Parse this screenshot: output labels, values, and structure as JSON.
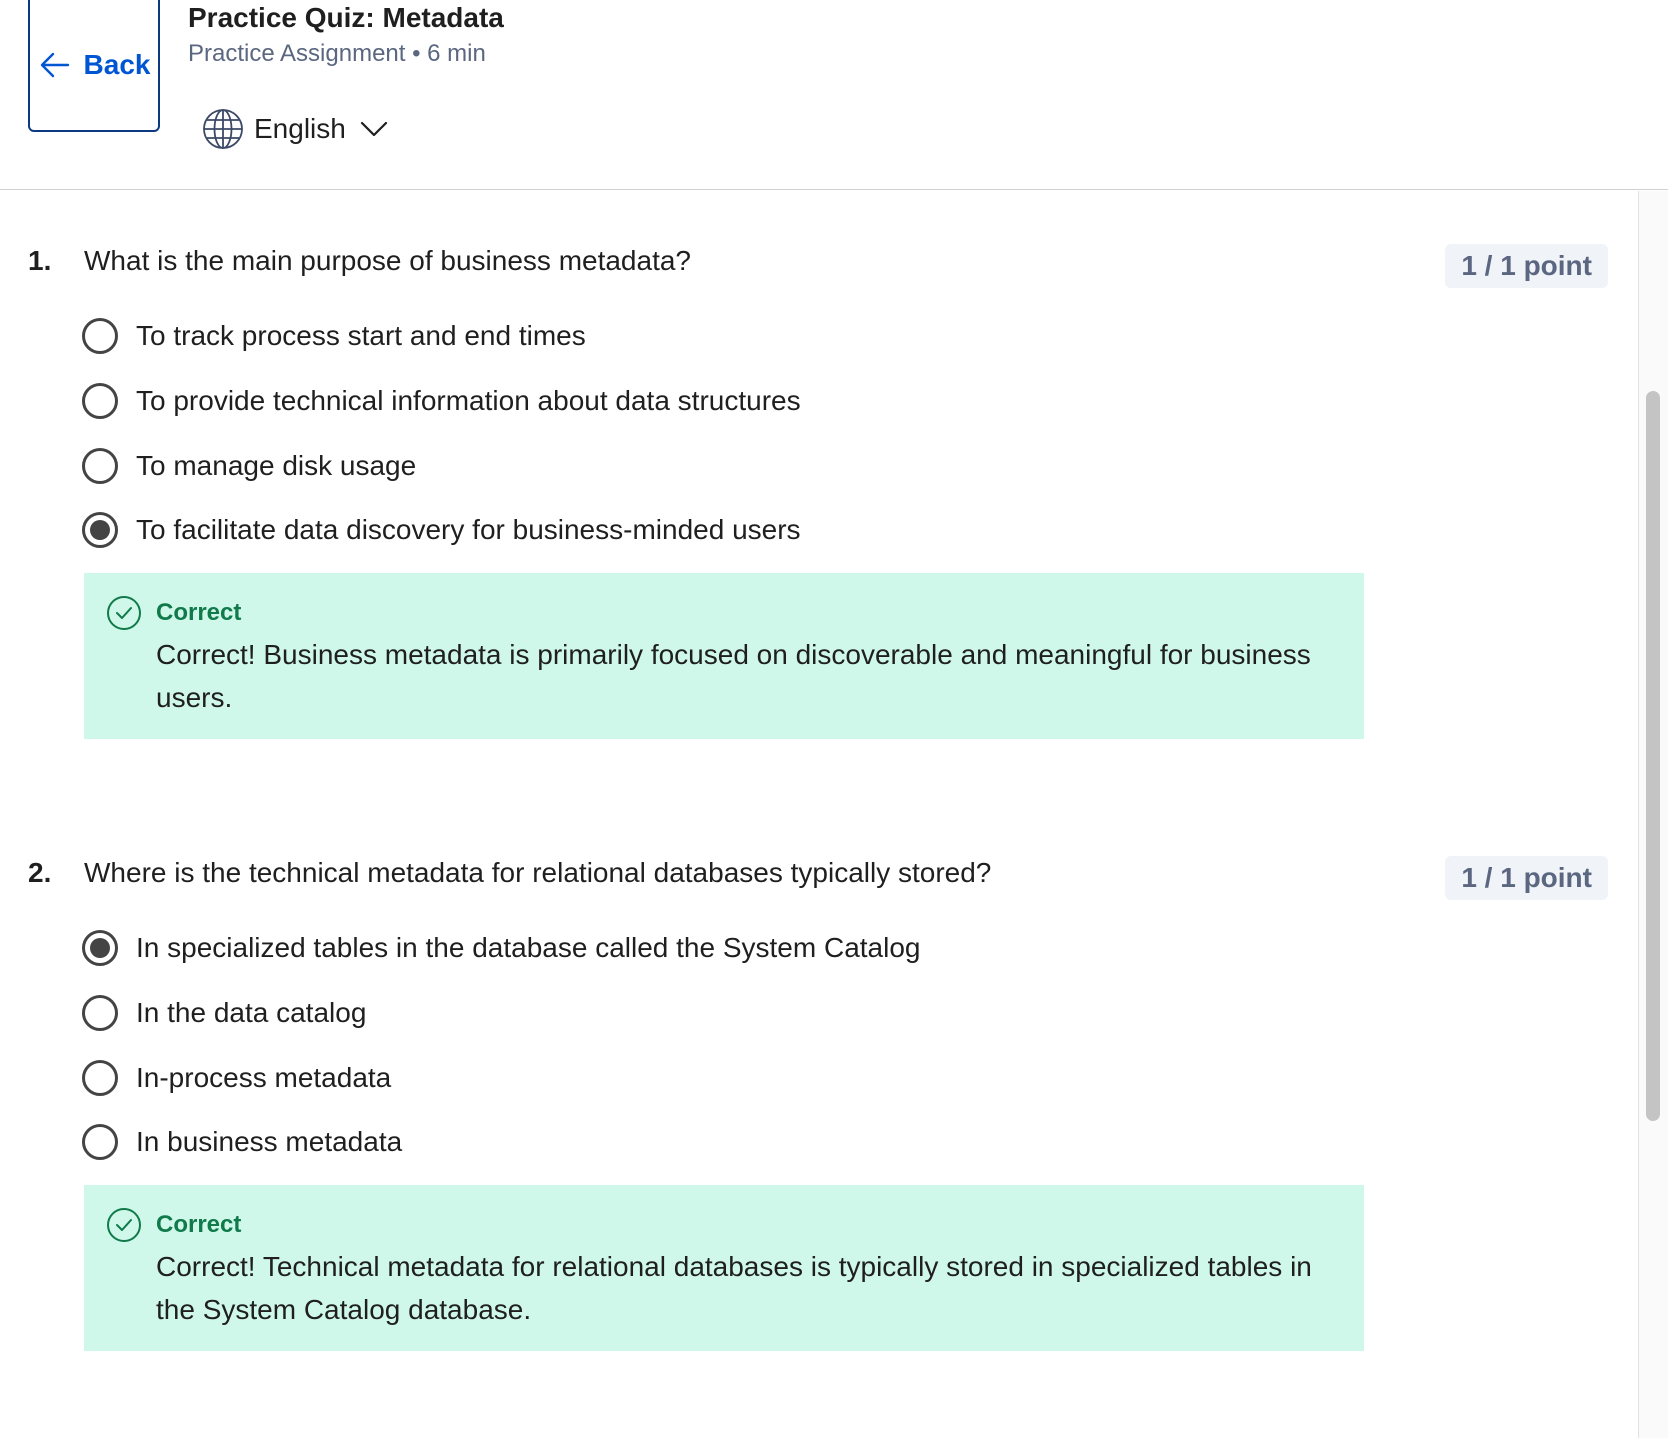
{
  "header": {
    "back_label": "Back",
    "title": "Practice Quiz: Metadata",
    "subtitle": "Practice Assignment • 6 min",
    "language": "English"
  },
  "questions": [
    {
      "number": "1.",
      "text": "What is the main purpose of business metadata?",
      "points": "1 / 1 point",
      "options": [
        {
          "label": "To track process start and end times",
          "selected": false
        },
        {
          "label": "To provide technical information about data structures",
          "selected": false
        },
        {
          "label": "To manage disk usage",
          "selected": false
        },
        {
          "label": "To facilitate data discovery for business-minded users",
          "selected": true
        }
      ],
      "feedback": {
        "status": "Correct",
        "text": "Correct! Business metadata is primarily focused on discoverable and meaningful for business users."
      }
    },
    {
      "number": "2.",
      "text": "Where is the technical metadata for relational databases typically stored?",
      "points": "1 / 1 point",
      "options": [
        {
          "label": "In specialized tables in the database called the System Catalog",
          "selected": true
        },
        {
          "label": "In the data catalog",
          "selected": false
        },
        {
          "label": "In-process metadata",
          "selected": false
        },
        {
          "label": "In business metadata",
          "selected": false
        }
      ],
      "feedback": {
        "status": "Correct",
        "text": "Correct! Technical metadata for relational databases is typically stored in specialized tables in the System Catalog database."
      }
    }
  ],
  "colors": {
    "accent": "#0056d2",
    "correct_bg": "#cff8ea",
    "correct_text": "#107a4a"
  }
}
